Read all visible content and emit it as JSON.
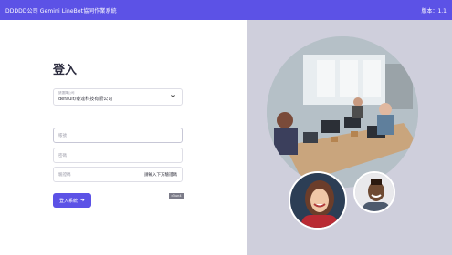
{
  "topbar": {
    "title": "DDDDD公司 Gemini LineBot協同作業系統",
    "version": "版本：1.1"
  },
  "login": {
    "title": "登入",
    "company_select": {
      "label": "請選擇公司",
      "value": "default/泰達科技有限公司",
      "icon": "chevron-down-icon"
    },
    "account_placeholder": "帳號",
    "password_placeholder": "密碼",
    "captcha_placeholder": "驗證碼",
    "captcha_hint": "請輸入下方驗證碼",
    "captcha_image_text": "d3un4",
    "submit_label": "登入系統",
    "submit_icon": "arrow-right-icon"
  },
  "colors": {
    "accent": "#5c52e6",
    "right_pane_bg": "#cfcfdc"
  }
}
